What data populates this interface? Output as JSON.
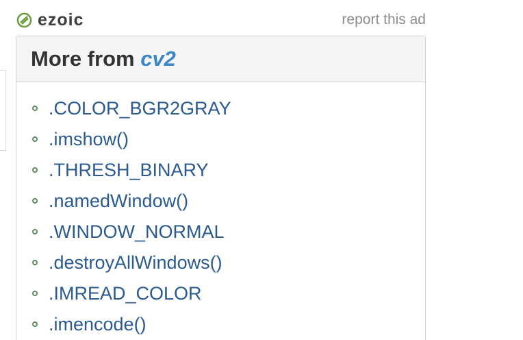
{
  "ad_bar": {
    "brand": "ezoic",
    "report_label": "report this ad",
    "logo_color": "#6a9b3c"
  },
  "panel": {
    "title_prefix": "More from",
    "module_name": "cv2",
    "accent_color": "#3a86c8",
    "items": [
      {
        "label": ".COLOR_BGR2GRAY"
      },
      {
        "label": ".imshow()"
      },
      {
        "label": ".THRESH_BINARY"
      },
      {
        "label": ".namedWindow()"
      },
      {
        "label": ".WINDOW_NORMAL"
      },
      {
        "label": ".destroyAllWindows()"
      },
      {
        "label": ".IMREAD_COLOR"
      },
      {
        "label": ".imencode()"
      }
    ]
  }
}
